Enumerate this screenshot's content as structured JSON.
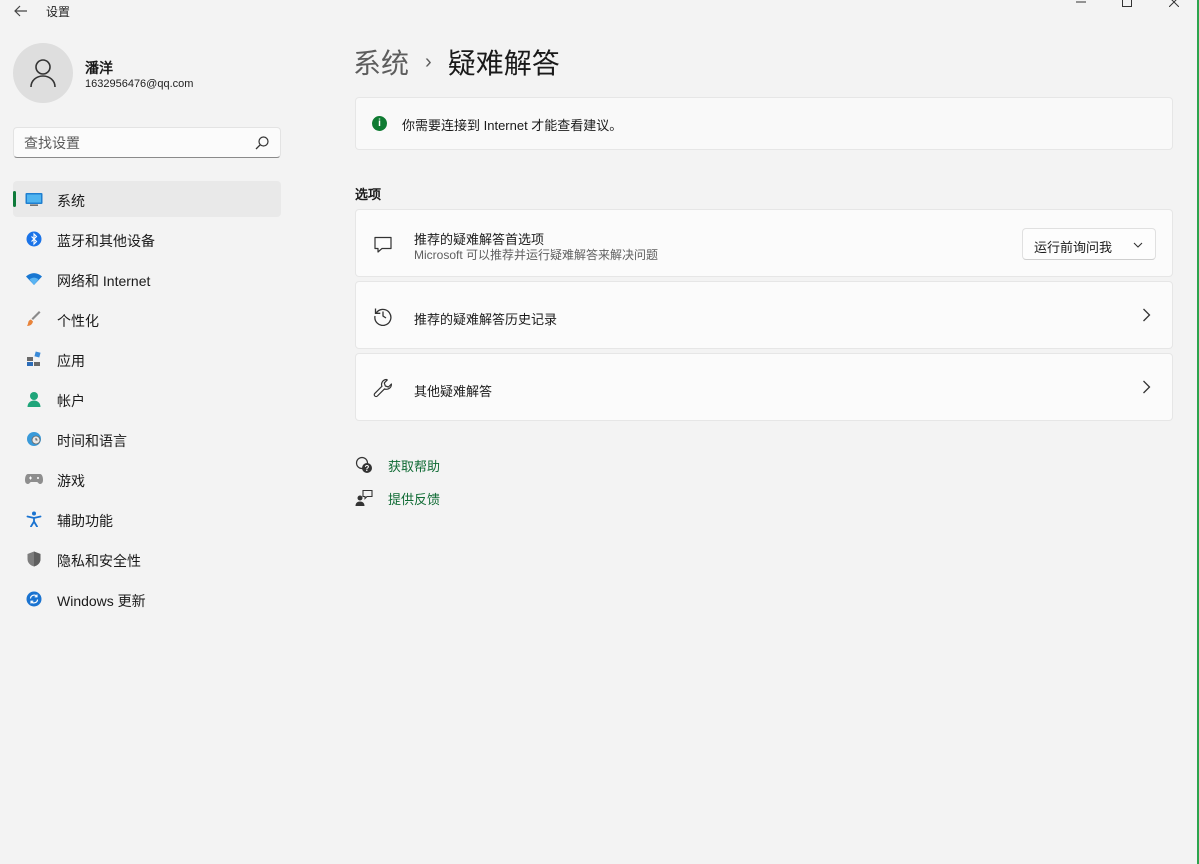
{
  "window": {
    "title": "设置",
    "back_icon": "back-arrow-icon",
    "controls": [
      "minimize-icon",
      "maximize-icon",
      "close-icon"
    ]
  },
  "profile": {
    "name": "潘洋",
    "email": "1632956476@qq.com",
    "avatar_icon": "person-icon"
  },
  "search": {
    "placeholder": "查找设置",
    "icon": "search-icon"
  },
  "sidebar": {
    "items": [
      {
        "label": "系统",
        "icon": "display-icon",
        "active": true
      },
      {
        "label": "蓝牙和其他设备",
        "icon": "bluetooth-icon"
      },
      {
        "label": "网络和 Internet",
        "icon": "wifi-icon"
      },
      {
        "label": "个性化",
        "icon": "brush-icon"
      },
      {
        "label": "应用",
        "icon": "apps-icon"
      },
      {
        "label": "帐户",
        "icon": "account-icon"
      },
      {
        "label": "时间和语言",
        "icon": "globe-clock-icon"
      },
      {
        "label": "游戏",
        "icon": "gamepad-icon"
      },
      {
        "label": "辅助功能",
        "icon": "accessibility-icon"
      },
      {
        "label": "隐私和安全性",
        "icon": "shield-icon"
      },
      {
        "label": "Windows 更新",
        "icon": "update-icon"
      }
    ]
  },
  "main": {
    "breadcrumb": {
      "parent": "系统",
      "separator": "›",
      "current": "疑难解答"
    },
    "notice": {
      "text": "你需要连接到 Internet 才能查看建议。",
      "icon": "info-icon",
      "color": "#0f7b32"
    },
    "section_title": "选项",
    "cards": [
      {
        "title": "推荐的疑难解答首选项",
        "subtitle": "Microsoft 可以推荐并运行疑难解答来解决问题",
        "icon": "chat-bubble-icon",
        "dropdown_value": "运行前询问我"
      },
      {
        "title": "推荐的疑难解答历史记录",
        "icon": "history-icon"
      },
      {
        "title": "其他疑难解答",
        "icon": "wrench-icon"
      }
    ],
    "links": [
      {
        "label": "获取帮助",
        "icon": "help-icon"
      },
      {
        "label": "提供反馈",
        "icon": "feedback-icon"
      }
    ]
  },
  "colors": {
    "accent": "#0e7a3a",
    "link": "#0e6a33",
    "background": "#f3f3f3"
  }
}
